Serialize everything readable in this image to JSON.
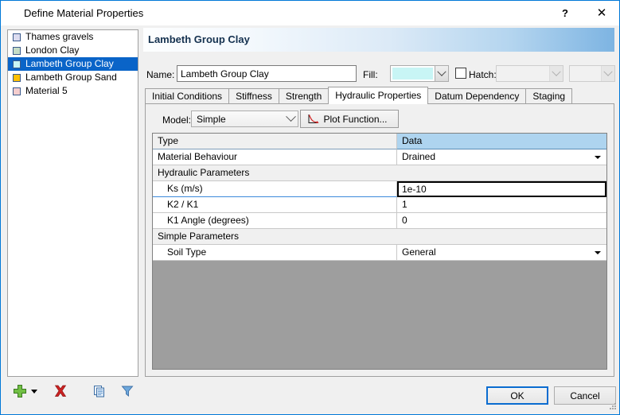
{
  "window": {
    "title": "Define Material Properties",
    "help_label": "?",
    "close_label": "✕"
  },
  "material_list": {
    "items": [
      {
        "label": "Thames gravels",
        "color": "#dcdcf0",
        "selected": false
      },
      {
        "label": "London Clay",
        "color": "#c6ddc6",
        "selected": false
      },
      {
        "label": "Lambeth Group Clay",
        "color": "#c8f5f5",
        "selected": true
      },
      {
        "label": "Lambeth Group Sand",
        "color": "#ffc000",
        "selected": false
      },
      {
        "label": "Material 5",
        "color": "#f5cdcd",
        "selected": false
      }
    ]
  },
  "panel": {
    "header_title": "Lambeth Group Clay",
    "name_label": "Name:",
    "name_value": "Lambeth Group Clay",
    "name_placeholder": "",
    "fill_label": "Fill:",
    "fill_color": "#c8f5f5",
    "hatch_label": "Hatch:",
    "hatch_checked": false,
    "hatch_pattern_value": "",
    "hatch_color_value": ""
  },
  "tabs": [
    {
      "label": "Initial Conditions",
      "active": false
    },
    {
      "label": "Stiffness",
      "active": false
    },
    {
      "label": "Strength",
      "active": false
    },
    {
      "label": "Hydraulic Properties",
      "active": true
    },
    {
      "label": "Datum Dependency",
      "active": false
    },
    {
      "label": "Staging",
      "active": false
    }
  ],
  "hydraulic": {
    "model_label": "Model:",
    "model_value": "Simple",
    "plot_function_label": "Plot Function...",
    "grid": {
      "header": {
        "type": "Type",
        "data": "Data"
      },
      "rows": [
        {
          "kind": "value",
          "type": "Material Behaviour",
          "data": "Drained",
          "dropdown": true,
          "indent": 0,
          "focused": false
        },
        {
          "kind": "section",
          "type": "Hydraulic Parameters",
          "data": "",
          "dropdown": false,
          "indent": 0,
          "focused": false
        },
        {
          "kind": "value",
          "type": "Ks (m/s)",
          "data": "1e-10",
          "dropdown": false,
          "indent": 1,
          "focused": true
        },
        {
          "kind": "value",
          "type": "K2 / K1",
          "data": "1",
          "dropdown": false,
          "indent": 1,
          "focused": false
        },
        {
          "kind": "value",
          "type": "K1 Angle (degrees)",
          "data": "0",
          "dropdown": false,
          "indent": 1,
          "focused": false
        },
        {
          "kind": "section",
          "type": "Simple Parameters",
          "data": "",
          "dropdown": false,
          "indent": 0,
          "focused": false
        },
        {
          "kind": "value",
          "type": "Soil Type",
          "data": "General",
          "dropdown": true,
          "indent": 1,
          "focused": false
        }
      ]
    }
  },
  "toolbar": {
    "add_icon": "plus-icon",
    "add_dropdown_icon": "chevron-down-icon",
    "delete_icon": "red-x-icon",
    "copy_icon": "copy-icon",
    "filter_icon": "funnel-icon"
  },
  "footer": {
    "ok_label": "OK",
    "cancel_label": "Cancel"
  },
  "colors": {
    "accent": "#0078d7",
    "selection": "#0a64c8",
    "grid_header": "#aed4ef",
    "grid_empty": "#9e9e9e"
  }
}
